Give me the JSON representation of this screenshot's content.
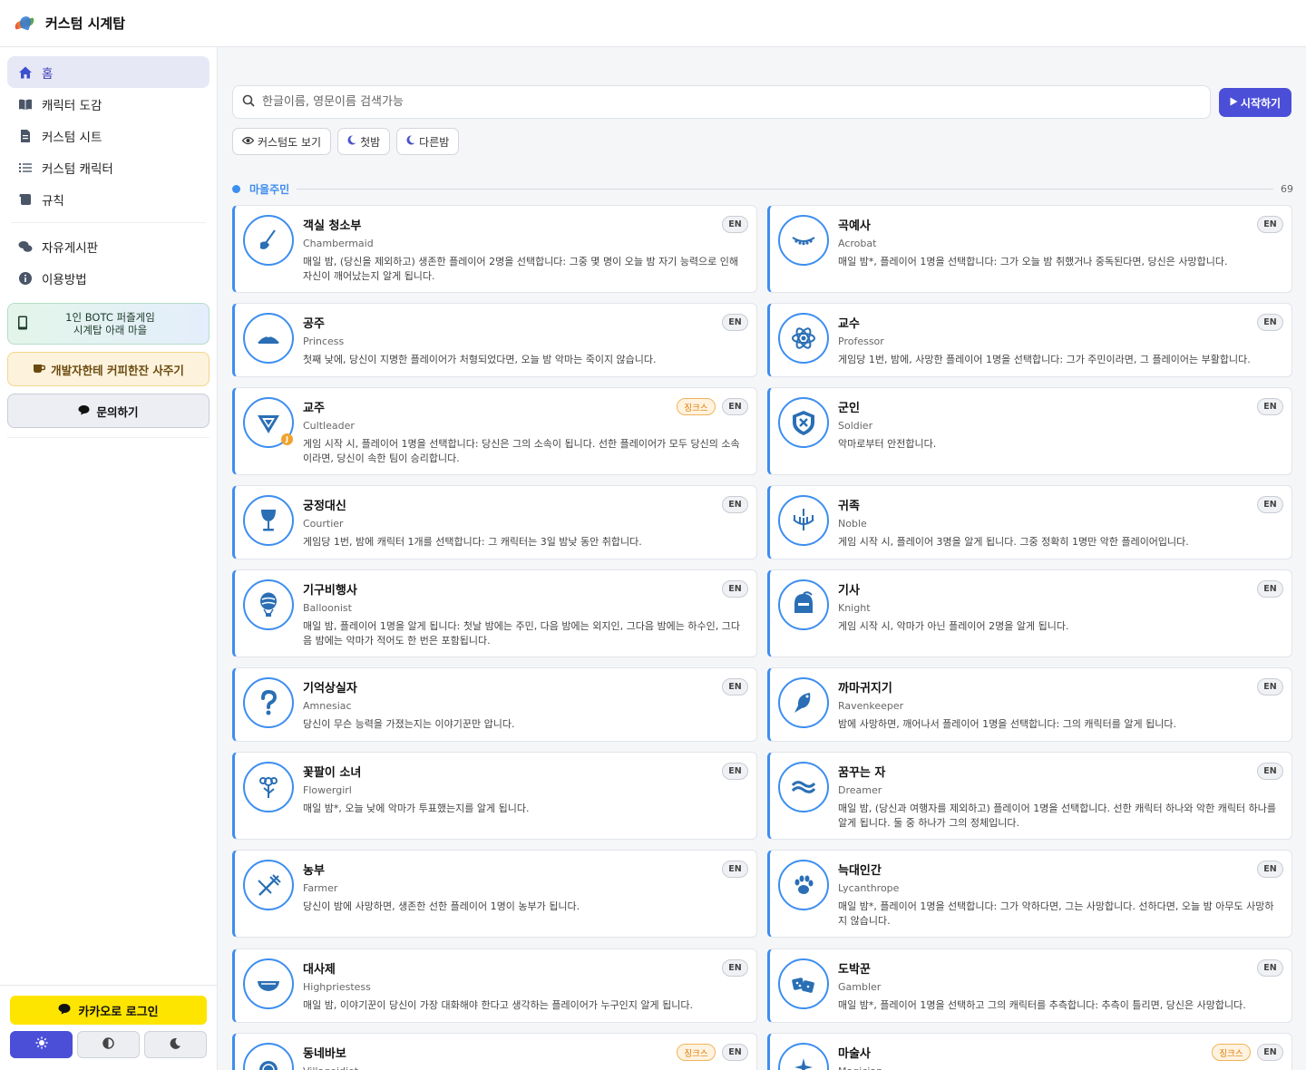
{
  "app": {
    "title": "커스텀 시계탑"
  },
  "sidebar": {
    "items": [
      {
        "label": "홈",
        "icon": "home-icon",
        "active": true
      },
      {
        "label": "캐릭터 도감",
        "icon": "book-icon"
      },
      {
        "label": "커스텀 시트",
        "icon": "document-icon"
      },
      {
        "label": "커스텀 캐릭터",
        "icon": "list-icon"
      },
      {
        "label": "규칙",
        "icon": "scroll-icon"
      }
    ],
    "items2": [
      {
        "label": "자유게시판",
        "icon": "chat-icon"
      },
      {
        "label": "이용방법",
        "icon": "info-icon"
      }
    ],
    "promo_puzzle": {
      "line1": "1인 BOTC 퍼즐게임",
      "line2": "시계탑 아래 마을"
    },
    "coffee_label": "개발자한테 커피한잔 사주기",
    "contact_label": "문의하기",
    "kakao_label": "카카오로 로그인"
  },
  "main": {
    "search_placeholder": "한글이름, 영문이름 검색가능",
    "start_label": "시작하기",
    "filters": [
      {
        "label": "커스텀도 보기",
        "icon": "eye-icon"
      },
      {
        "label": "첫밤",
        "icon": "moon-icon"
      },
      {
        "label": "다른밤",
        "icon": "moon-icon"
      }
    ],
    "section": {
      "title": "마을주민",
      "count": "69"
    },
    "badges": {
      "en": "EN",
      "jinx": "징크스"
    },
    "cards": [
      {
        "name": "객실 청소부",
        "eng": "Chambermaid",
        "desc": "매일 밤, (당신을 제외하고) 생존한 플레이어 2명을 선택합니다: 그중 몇 명이 오늘 밤 자기 능력으로 인해 자신이 깨어났는지 알게 됩니다.",
        "jinx": false,
        "icon": "mop-icon"
      },
      {
        "name": "곡예사",
        "eng": "Acrobat",
        "desc": "매일 밤*, 플레이어 1명을 선택합니다: 그가 오늘 밤 취했거나 중독된다면, 당신은 사망합니다.",
        "jinx": false,
        "icon": "acrobat-icon"
      },
      {
        "name": "공주",
        "eng": "Princess",
        "desc": "첫째 낮에, 당신이 지명한 플레이어가 처형되었다면, 오늘 밤 악마는 죽이지 않습니다.",
        "jinx": false,
        "icon": "tiara-icon"
      },
      {
        "name": "교수",
        "eng": "Professor",
        "desc": "게임당 1번, 밤에, 사망한 플레이어 1명을 선택합니다: 그가 주민이라면, 그 플레이어는 부활합니다.",
        "jinx": false,
        "icon": "atom-icon"
      },
      {
        "name": "교주",
        "eng": "Cultleader",
        "desc": "게임 시작 시, 플레이어 1명을 선택합니다: 당신은 그의 소속이 됩니다. 선한 플레이어가 모두 당신의 소속이라면, 당신이 속한 팀이 승리합니다.",
        "jinx": true,
        "icon": "cult-icon"
      },
      {
        "name": "군인",
        "eng": "Soldier",
        "desc": "악마로부터 안전합니다.",
        "jinx": false,
        "icon": "shield-icon"
      },
      {
        "name": "궁정대신",
        "eng": "Courtier",
        "desc": "게임당 1번, 밤에 캐릭터 1개를 선택합니다: 그 캐릭터는 3일 밤낮 동안 취합니다.",
        "jinx": false,
        "icon": "goblet-icon"
      },
      {
        "name": "귀족",
        "eng": "Noble",
        "desc": "게임 시작 시, 플레이어 3명을 알게 됩니다. 그중 정확히 1명만 악한 플레이어입니다.",
        "jinx": false,
        "icon": "chandelier-icon"
      },
      {
        "name": "기구비행사",
        "eng": "Balloonist",
        "desc": "매일 밤, 플레이어 1명을 알게 됩니다: 첫날 밤에는 주민, 다음 밤에는 외지인, 그다음 밤에는 하수인, 그다음 밤에는 악마가 적어도 한 번은 포함됩니다.",
        "jinx": false,
        "icon": "balloon-icon"
      },
      {
        "name": "기사",
        "eng": "Knight",
        "desc": "게임 시작 시, 악마가 아닌 플레이어 2명을 알게 됩니다.",
        "jinx": false,
        "icon": "helmet-icon"
      },
      {
        "name": "기억상실자",
        "eng": "Amnesiac",
        "desc": "당신이 무슨 능력을 가졌는지는 이야기꾼만 압니다.",
        "jinx": false,
        "icon": "question-icon"
      },
      {
        "name": "까마귀지기",
        "eng": "Ravenkeeper",
        "desc": "밤에 사망하면, 깨어나서 플레이어 1명을 선택합니다: 그의 캐릭터를 알게 됩니다.",
        "jinx": false,
        "icon": "raven-icon"
      },
      {
        "name": "꽃팔이 소녀",
        "eng": "Flowergirl",
        "desc": "매일 밤*, 오늘 낮에 악마가 투표했는지를 알게 됩니다.",
        "jinx": false,
        "icon": "flower-icon"
      },
      {
        "name": "꿈꾸는 자",
        "eng": "Dreamer",
        "desc": "매일 밤, (당신과 여행자를 제외하고) 플레이어 1명을 선택합니다. 선한 캐릭터 하나와 악한 캐릭터 하나를 알게 됩니다. 둘 중 하나가 그의 정체입니다.",
        "jinx": false,
        "icon": "dream-icon"
      },
      {
        "name": "농부",
        "eng": "Farmer",
        "desc": "당신이 밤에 사망하면, 생존한 선한 플레이어 1명이 농부가 됩니다.",
        "jinx": false,
        "icon": "pitchfork-icon"
      },
      {
        "name": "늑대인간",
        "eng": "Lycanthrope",
        "desc": "매일 밤*, 플레이어 1명을 선택합니다: 그가 악하다면, 그는 사망합니다. 선하다면, 오늘 밤 아무도 사망하지 않습니다.",
        "jinx": false,
        "icon": "paw-icon"
      },
      {
        "name": "대사제",
        "eng": "Highpriestess",
        "desc": "매일 밤, 이야기꾼이 당신이 가장 대화해야 한다고 생각하는 플레이어가 누구인지 알게 됩니다.",
        "jinx": false,
        "icon": "bowl-icon"
      },
      {
        "name": "도박꾼",
        "eng": "Gambler",
        "desc": "매일 밤*, 플레이어 1명을 선택하고 그의 캐릭터를 추측합니다: 추측이 틀리면, 당신은 사망합니다.",
        "jinx": false,
        "icon": "dice-icon"
      },
      {
        "name": "동네바보",
        "eng": "Villageidiot",
        "desc": "",
        "jinx": true,
        "icon": "shell-icon"
      },
      {
        "name": "마술사",
        "eng": "Magician",
        "desc": "",
        "jinx": true,
        "icon": "magic-icon"
      }
    ]
  }
}
